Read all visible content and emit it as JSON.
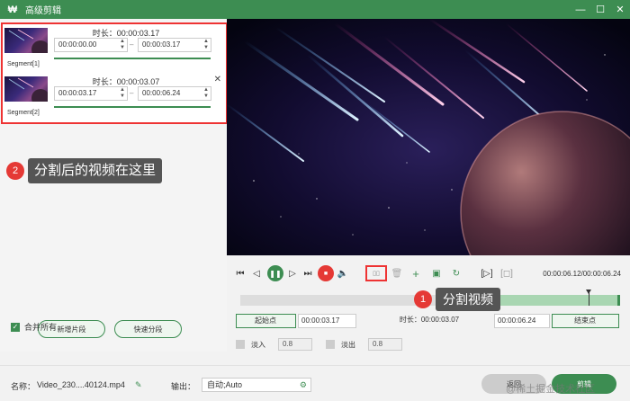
{
  "window": {
    "title": "高级剪辑",
    "logo": "₩",
    "minimize": "—",
    "maximize": "☐",
    "close": "✕"
  },
  "segments": [
    {
      "label": "Segment[1]",
      "duration": "时长：00:00:03.17",
      "start": "00:00:00.00",
      "end": "00:00:03.17"
    },
    {
      "label": "Segment[2]",
      "duration": "时长：00:00:03.07",
      "start": "00:00:03.17",
      "end": "00:00:06.24"
    }
  ],
  "callouts": {
    "c2_num": "2",
    "c2_text": "分割后的视频在这里",
    "c1_num": "1",
    "c1_text": "分割视频"
  },
  "left_buttons": {
    "add_segment": "新增片段",
    "quick_split": "快速分段"
  },
  "merge_all": {
    "label": "合并所有",
    "checked": true
  },
  "player": {
    "timecode": "00:00:06.12/00:00:06.24"
  },
  "range": {
    "start_label": "起始点",
    "start_time": "00:00:03.17",
    "duration": "时长：00:00:03.07",
    "end_time": "00:00:06.24",
    "end_label": "结束点"
  },
  "fade": {
    "in_label": "淡入",
    "in_value": "0.8",
    "out_label": "淡出",
    "out_value": "0.8"
  },
  "bottom": {
    "name_label": "名称：",
    "name_value": "Video_230....40124.mp4",
    "output_label": "输出：",
    "output_value": "自动;Auto",
    "back_button": "返回",
    "cut_button": "剪辑"
  },
  "watermark": "@稀土掘金技术社区",
  "colors": {
    "accent": "#3d8d52",
    "highlight": "#e33333",
    "badge": "#e53935"
  }
}
